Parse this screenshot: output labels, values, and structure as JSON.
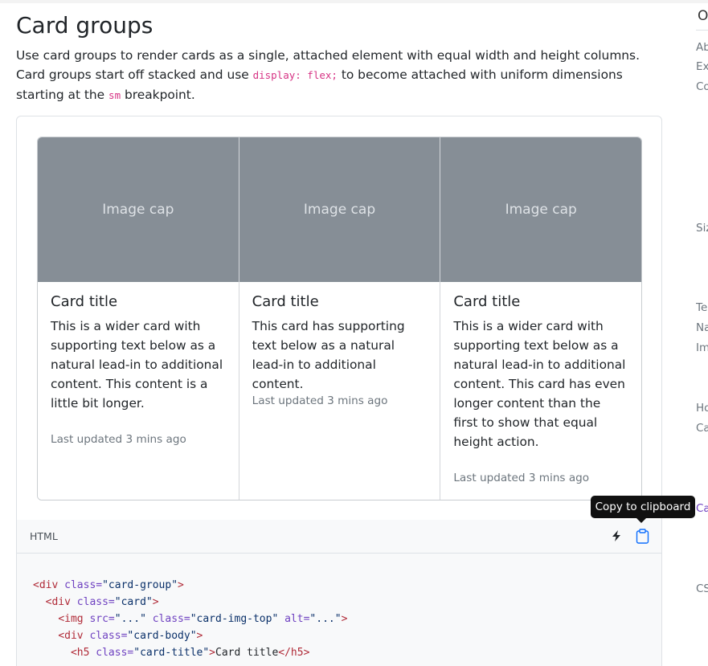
{
  "section": {
    "title": "Card groups",
    "intro_1": "Use card groups to render cards as a single, attached element with equal width and height columns. Card groups start off stacked and use ",
    "intro_code1": "display: flex;",
    "intro_2": " to become attached with uniform dimensions starting at the ",
    "intro_code2": "sm",
    "intro_3": " breakpoint."
  },
  "cards": [
    {
      "img": "Image cap",
      "title": "Card title",
      "text": "This is a wider card with supporting text below as a natural lead-in to additional content. This content is a little bit longer.",
      "foot": "Last updated 3 mins ago"
    },
    {
      "img": "Image cap",
      "title": "Card title",
      "text": "This card has supporting text below as a natural lead-in to additional content.",
      "foot": "Last updated 3 mins ago"
    },
    {
      "img": "Image cap",
      "title": "Card title",
      "text": "This is a wider card with supporting text below as a natural lead-in to additional content. This card has even longer content than the first to show that equal height action.",
      "foot": "Last updated 3 mins ago"
    }
  ],
  "code": {
    "lang": "HTML",
    "tooltip": "Copy to clipboard",
    "icons": [
      "lightning-icon",
      "clipboard-icon"
    ]
  },
  "toc": {
    "head": "O",
    "items": [
      "Ab",
      "Ex",
      "Co",
      "Siz",
      "Te",
      "Na",
      "Im",
      "Ho",
      "Ca",
      "Ca",
      "CS"
    ]
  }
}
